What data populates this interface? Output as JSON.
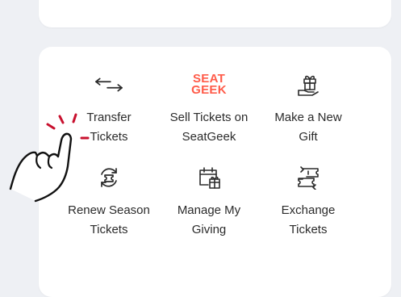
{
  "actions": [
    {
      "id": "transfer",
      "line1": "Transfer",
      "line2": "Tickets",
      "icon": "transfer-arrows-icon"
    },
    {
      "id": "sell",
      "line1": "Sell Tickets on",
      "line2": "SeatGeek",
      "icon": "seatgeek-logo",
      "logo_line1": "SEAT",
      "logo_line2": "GEEK"
    },
    {
      "id": "gift",
      "line1": "Make a New",
      "line2": "Gift",
      "icon": "gift-hand-icon"
    },
    {
      "id": "renew",
      "line1": "Renew Season",
      "line2": "Tickets",
      "icon": "renew-ticket-icon"
    },
    {
      "id": "giving",
      "line1": "Manage My",
      "line2": "Giving",
      "icon": "calendar-gift-icon"
    },
    {
      "id": "exchange",
      "line1": "Exchange",
      "line2": "Tickets",
      "icon": "exchange-tickets-icon"
    }
  ],
  "colors": {
    "background": "#eef0f4",
    "card": "#ffffff",
    "text": "#2b2b2b",
    "seatgeek_red": "#ff5b49",
    "tap_indicator": "#c8102e"
  },
  "overlay": {
    "icon": "tap-hand-pointer-icon"
  }
}
